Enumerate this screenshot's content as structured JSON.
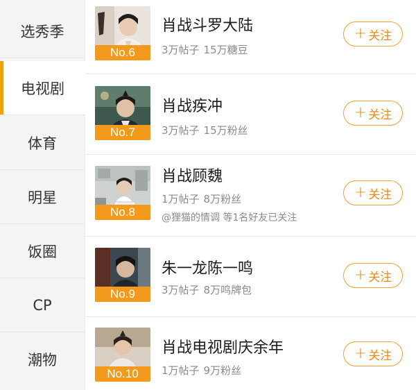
{
  "sidebar": {
    "items": [
      {
        "label": "选秀季",
        "active": false
      },
      {
        "label": "电视剧",
        "active": true
      },
      {
        "label": "体育",
        "active": false
      },
      {
        "label": "明星",
        "active": false
      },
      {
        "label": "饭圈",
        "active": false
      },
      {
        "label": "CP",
        "active": false
      },
      {
        "label": "潮物",
        "active": false
      }
    ]
  },
  "follow_label": "关注",
  "follow_plus": "+",
  "rows": [
    {
      "rank": "No.6",
      "title": "肖战斗罗大陆",
      "posts": "3万帖子",
      "fans": "15万糖豆"
    },
    {
      "rank": "No.7",
      "title": "肖战疾冲",
      "posts": "3万帖子",
      "fans": "15万粉丝"
    },
    {
      "rank": "No.8",
      "title": "肖战顾魏",
      "posts": "1万帖子",
      "fans": "8万粉丝",
      "friends": "@狸猫的情调 等1名好友已关注"
    },
    {
      "rank": "No.9",
      "title": "朱一龙陈一鸣",
      "posts": "3万帖子",
      "fans": "8万鸣牌包"
    },
    {
      "rank": "No.10",
      "title": "肖战电视剧庆余年",
      "posts": "1万帖子",
      "fans": "9万粉丝"
    }
  ],
  "colors": {
    "accent": "#f39a1d",
    "follow_text": "#ee8a12",
    "sidebar_bg": "#f4f4f4"
  }
}
